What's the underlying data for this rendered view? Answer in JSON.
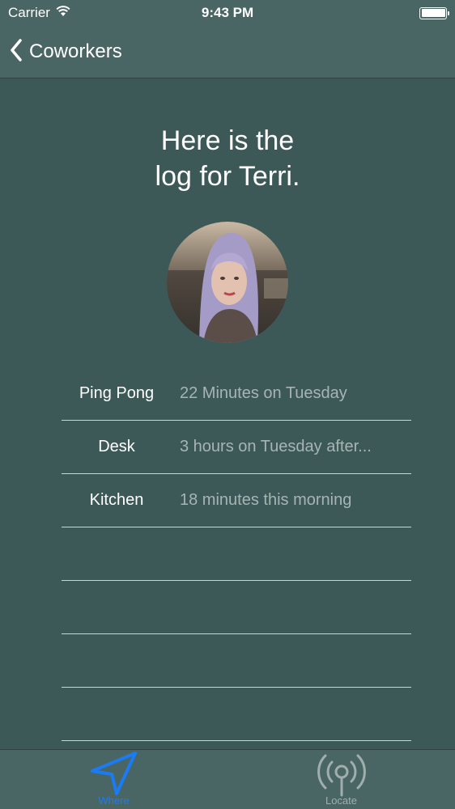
{
  "status_bar": {
    "carrier": "Carrier",
    "time": "9:43 PM"
  },
  "nav": {
    "back_label": "Coworkers"
  },
  "heading": {
    "line1": "Here is the",
    "line2": "log for Terri."
  },
  "log": [
    {
      "place": "Ping Pong",
      "time": "22 Minutes on Tuesday"
    },
    {
      "place": "Desk",
      "time": "3 hours on Tuesday after..."
    },
    {
      "place": "Kitchen",
      "time": "18 minutes this morning"
    },
    {
      "place": "",
      "time": ""
    },
    {
      "place": "",
      "time": ""
    },
    {
      "place": "",
      "time": ""
    },
    {
      "place": "",
      "time": ""
    }
  ],
  "tabs": [
    {
      "label": "Where",
      "icon": "location-arrow-icon",
      "active": true
    },
    {
      "label": "Locate",
      "icon": "broadcast-antenna-icon",
      "active": false
    }
  ],
  "colors": {
    "background": "#3d5957",
    "bar": "#4a6664",
    "active_tab": "#1a7cf5",
    "inactive_tab": "#a0aeae"
  }
}
